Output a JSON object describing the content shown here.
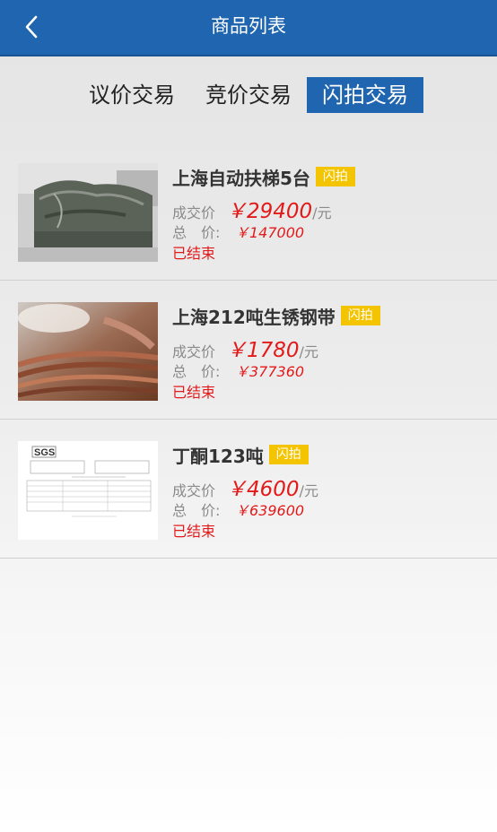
{
  "header": {
    "title": "商品列表",
    "back_icon": "chevron-left-icon",
    "background": "#2065b0"
  },
  "tabs": [
    {
      "label": "议价交易",
      "active": false
    },
    {
      "label": "竞价交易",
      "active": false
    },
    {
      "label": "闪拍交易",
      "active": true
    }
  ],
  "colors": {
    "accent": "#2065b0",
    "price": "#e21a1a",
    "badge": "#f5c400"
  },
  "items": [
    {
      "title": "上海自动扶梯5台",
      "badge": "闪拍",
      "deal_label": "成交价",
      "deal_price": "￥29400",
      "unit": "/元",
      "total_label": "总　价:",
      "total_price": "￥147000",
      "status": "已结束",
      "image": "escalator-photo"
    },
    {
      "title": "上海212吨生锈钢带",
      "badge": "闪拍",
      "deal_label": "成交价",
      "deal_price": "￥1780",
      "unit": "/元",
      "total_label": "总　价:",
      "total_price": "￥377360",
      "status": "已结束",
      "image": "steel-coil-photo"
    },
    {
      "title": "丁酮123吨",
      "badge": "闪拍",
      "deal_label": "成交价",
      "deal_price": "￥4600",
      "unit": "/元",
      "total_label": "总　价:",
      "total_price": "￥639600",
      "status": "已结束",
      "image": "sgs-report-document",
      "image_text": "SGS"
    }
  ]
}
